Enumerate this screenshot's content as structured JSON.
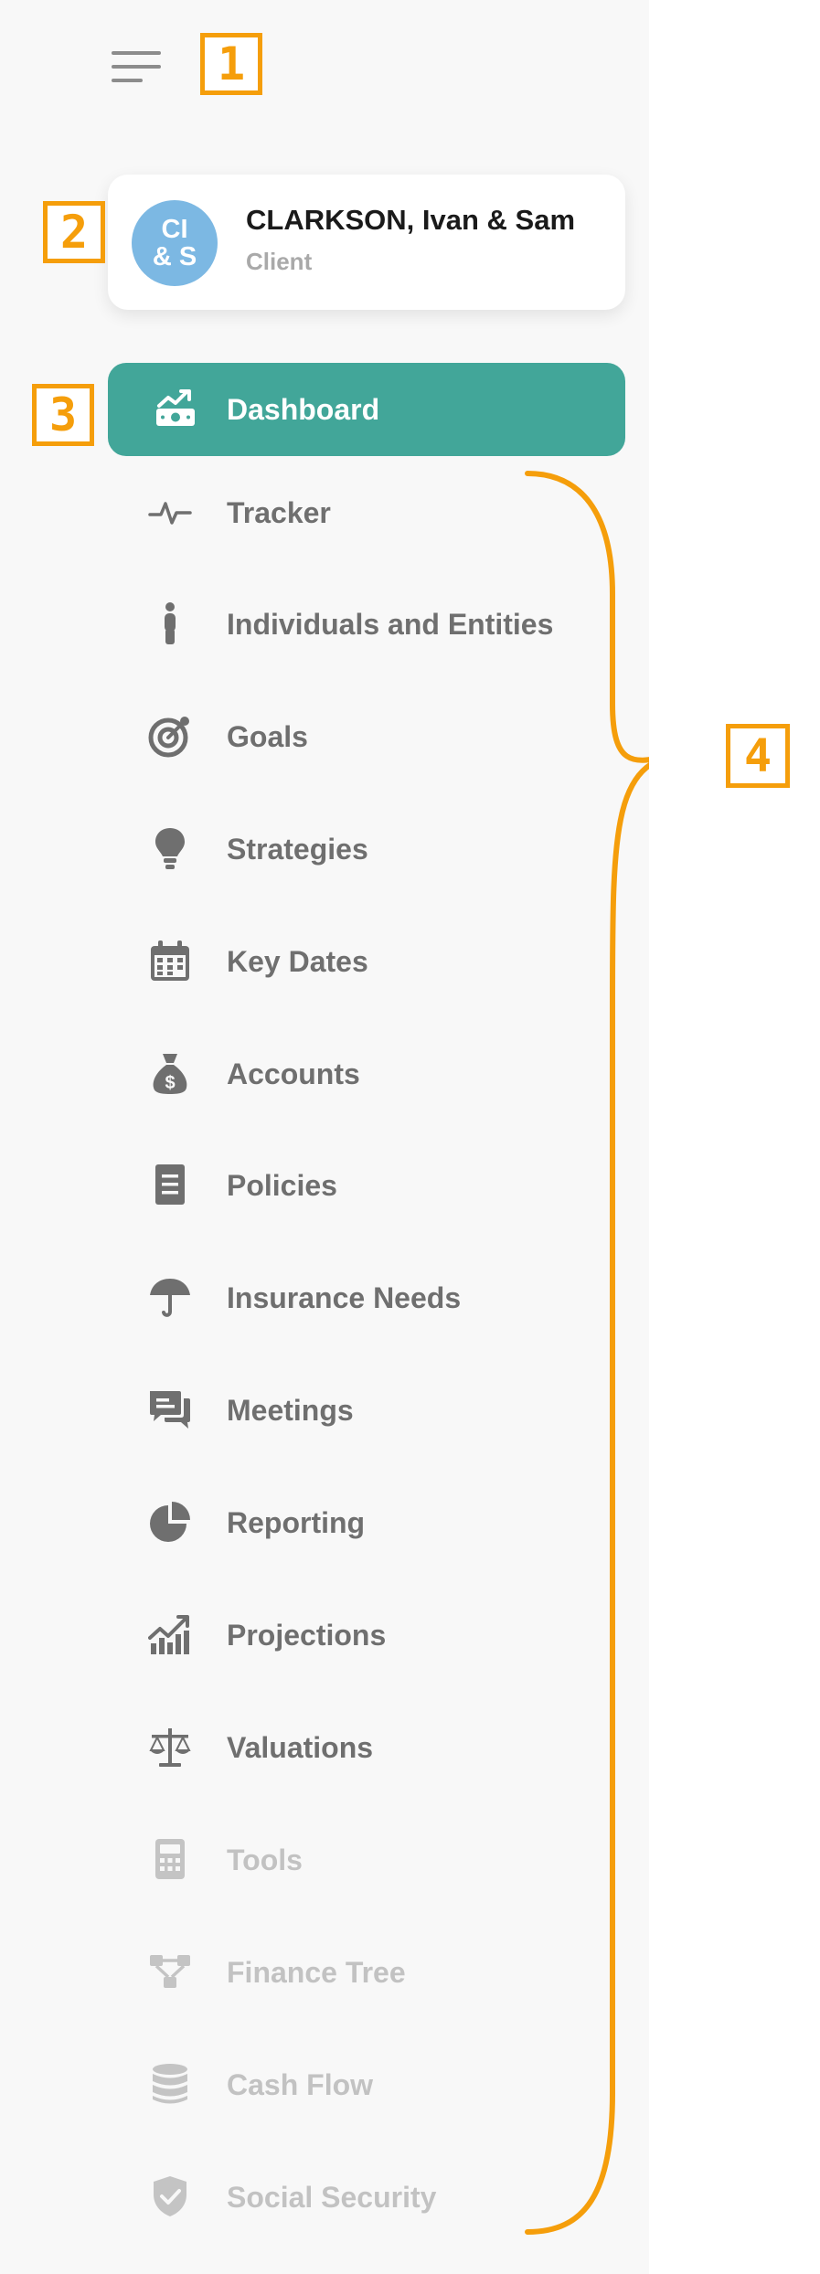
{
  "sidebar": {
    "menu_icon": "hamburger-menu-icon",
    "client": {
      "avatar_line1": "CI",
      "avatar_line2": "& S",
      "name": "CLARKSON, Ivan & Sam",
      "role": "Client"
    },
    "active_item": {
      "label": "Dashboard",
      "icon": "dashboard-icon"
    },
    "items": [
      {
        "label": "Tracker",
        "icon": "activity-icon",
        "enabled": true
      },
      {
        "label": "Individuals and Entities",
        "icon": "person-icon",
        "enabled": true
      },
      {
        "label": "Goals",
        "icon": "target-icon",
        "enabled": true
      },
      {
        "label": "Strategies",
        "icon": "lightbulb-icon",
        "enabled": true
      },
      {
        "label": "Key Dates",
        "icon": "calendar-icon",
        "enabled": true
      },
      {
        "label": "Accounts",
        "icon": "money-bag-icon",
        "enabled": true
      },
      {
        "label": "Policies",
        "icon": "document-icon",
        "enabled": true
      },
      {
        "label": "Insurance Needs",
        "icon": "umbrella-icon",
        "enabled": true
      },
      {
        "label": "Meetings",
        "icon": "chat-icon",
        "enabled": true
      },
      {
        "label": "Reporting",
        "icon": "pie-chart-icon",
        "enabled": true
      },
      {
        "label": "Projections",
        "icon": "growth-chart-icon",
        "enabled": true
      },
      {
        "label": "Valuations",
        "icon": "scale-icon",
        "enabled": true
      },
      {
        "label": "Tools",
        "icon": "calculator-icon",
        "enabled": false
      },
      {
        "label": "Finance Tree",
        "icon": "tree-nodes-icon",
        "enabled": false
      },
      {
        "label": "Cash Flow",
        "icon": "database-icon",
        "enabled": false
      },
      {
        "label": "Social Security",
        "icon": "shield-icon",
        "enabled": false
      }
    ]
  },
  "annotations": {
    "callout_1": "1",
    "callout_2": "2",
    "callout_3": "3",
    "callout_4": "4",
    "color": "#f59e0b"
  },
  "colors": {
    "accent": "#42a699",
    "avatar": "#7cb8e3",
    "item_text": "#6f6f6f",
    "item_text_disabled": "#c2c2c2"
  }
}
